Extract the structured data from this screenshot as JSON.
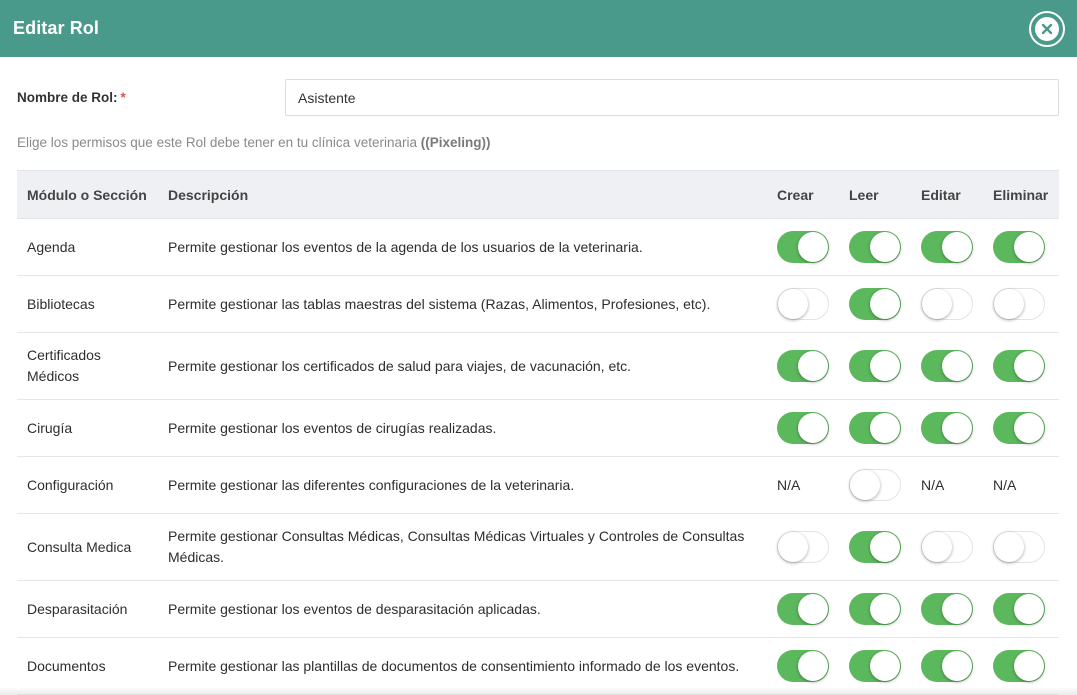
{
  "modal": {
    "title": "Editar Rol",
    "close_icon": "close-icon",
    "accent_color": "#4a9a8b"
  },
  "form": {
    "name_label": "Nombre de Rol:",
    "required_mark": "*",
    "name_value": "Asistente",
    "hint_prefix": "Elige los permisos que este Rol debe tener en tu clínica veterinaria",
    "hint_clinic": "((Pixeling))"
  },
  "table": {
    "headers": {
      "module": "Módulo o Sección",
      "description": "Descripción",
      "create": "Crear",
      "read": "Leer",
      "edit": "Editar",
      "delete": "Eliminar"
    },
    "na_label": "N/A",
    "toggle_on_color": "#5cb85c",
    "rows": [
      {
        "module": "Agenda",
        "description": "Permite gestionar los eventos de la agenda de los usuarios de la veterinaria.",
        "create": "on",
        "read": "on",
        "edit": "on",
        "delete": "on"
      },
      {
        "module": "Bibliotecas",
        "description": "Permite gestionar las tablas maestras del sistema (Razas, Alimentos, Profesiones, etc).",
        "create": "off",
        "read": "on",
        "edit": "off",
        "delete": "off"
      },
      {
        "module": "Certificados Médicos",
        "description": "Permite gestionar los certificados de salud para viajes, de vacunación, etc.",
        "create": "on",
        "read": "on",
        "edit": "on",
        "delete": "on"
      },
      {
        "module": "Cirugía",
        "description": "Permite gestionar los eventos de cirugías realizadas.",
        "create": "on",
        "read": "on",
        "edit": "on",
        "delete": "on"
      },
      {
        "module": "Configuración",
        "description": "Permite gestionar las diferentes configuraciones de la veterinaria.",
        "create": "na",
        "read": "off",
        "edit": "na",
        "delete": "na"
      },
      {
        "module": "Consulta Medica",
        "description": "Permite gestionar Consultas Médicas, Consultas Médicas Virtuales y Controles de Consultas Médicas.",
        "create": "off",
        "read": "on",
        "edit": "off",
        "delete": "off"
      },
      {
        "module": "Desparasitación",
        "description": "Permite gestionar los eventos de desparasitación aplicadas.",
        "create": "on",
        "read": "on",
        "edit": "on",
        "delete": "on"
      },
      {
        "module": "Documentos",
        "description": "Permite gestionar las plantillas de documentos de consentimiento informado de los eventos.",
        "create": "on",
        "read": "on",
        "edit": "on",
        "delete": "on"
      }
    ]
  }
}
